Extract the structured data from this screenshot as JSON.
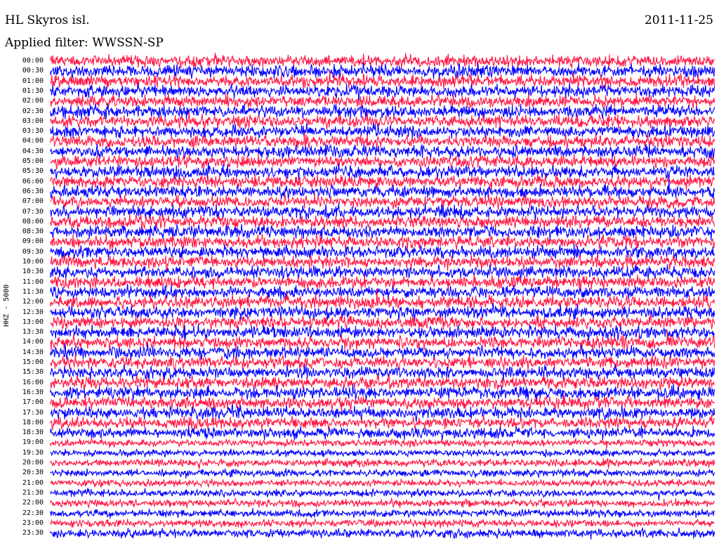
{
  "header": {
    "station": "HL Skyros isl.",
    "date": "2011-11-25",
    "filter": "Applied filter: WWSSN-SP"
  },
  "chart_data": {
    "type": "line",
    "title": "HL Skyros isl.",
    "subtitle": "Applied filter: WWSSN-SP",
    "date": "2011-11-25",
    "ylabel": "HHZ - 5000",
    "grid": false,
    "row_interval_minutes": 30,
    "row_labels": [
      "00:00",
      "00:30",
      "01:00",
      "01:30",
      "02:00",
      "02:30",
      "03:00",
      "03:30",
      "04:00",
      "04:30",
      "05:00",
      "05:30",
      "06:00",
      "06:30",
      "07:00",
      "07:30",
      "08:00",
      "08:30",
      "09:00",
      "09:30",
      "10:00",
      "10:30",
      "11:00",
      "11:30",
      "12:00",
      "12:30",
      "13:00",
      "13:30",
      "14:00",
      "14:30",
      "15:00",
      "15:30",
      "16:00",
      "16:30",
      "17:00",
      "17:30",
      "18:00",
      "18:30",
      "19:00",
      "19:30",
      "20:00",
      "20:30",
      "21:00",
      "21:30",
      "22:00",
      "22:30",
      "23:00",
      "23:30"
    ],
    "series_colors": [
      "#ff1744",
      "#0000ff"
    ],
    "relative_amplitude": [
      1.0,
      1.0,
      1.0,
      1.0,
      1.0,
      1.0,
      1.0,
      1.0,
      1.0,
      1.0,
      1.0,
      1.0,
      1.0,
      1.0,
      1.0,
      1.0,
      1.0,
      1.0,
      1.0,
      1.0,
      1.0,
      1.0,
      1.0,
      1.0,
      1.0,
      1.0,
      1.0,
      1.0,
      1.0,
      1.0,
      1.0,
      1.0,
      1.0,
      1.0,
      1.0,
      1.0,
      0.95,
      0.9,
      0.6,
      0.55,
      0.65,
      0.6,
      0.55,
      0.6,
      0.6,
      0.6,
      0.6,
      0.7
    ]
  }
}
